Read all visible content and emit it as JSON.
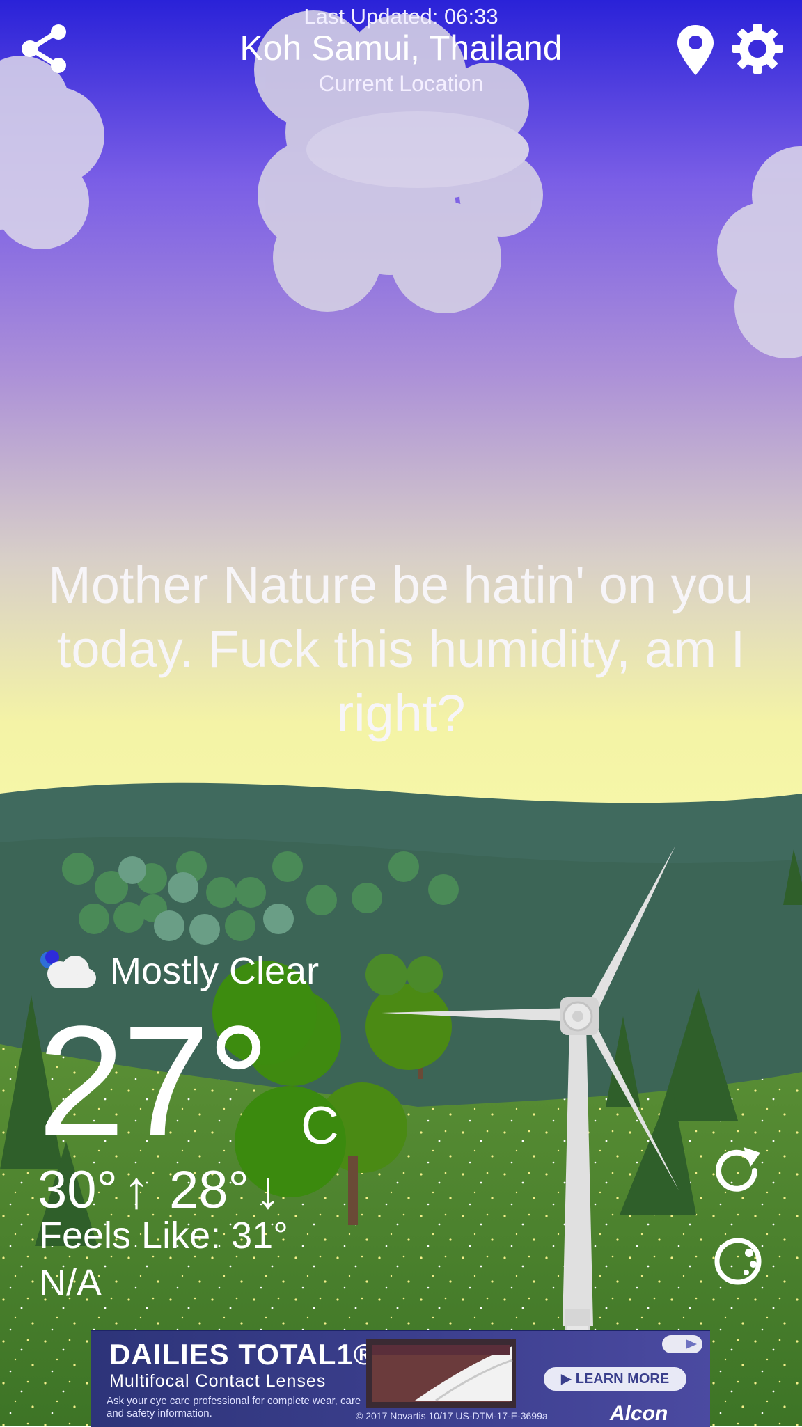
{
  "header": {
    "last_updated": "Last Updated: 06:33",
    "location": "Koh Samui, Thailand",
    "location_subtitle": "Current Location"
  },
  "message": "Mother Nature be hatin' on you today. Fuck this humidity, am I right?",
  "weather": {
    "condition_icon": "partly-cloudy-night-icon",
    "condition": "Mostly Clear",
    "temperature": "27°",
    "unit": "C",
    "high": "30°",
    "low": "28°",
    "high_arrow": "↑",
    "low_arrow": "↓",
    "feels_like_label": "Feels Like:",
    "feels_like_value": "31°",
    "extra": "N/A"
  },
  "actions": {
    "share_icon": "share-icon",
    "location_icon": "location-pin-icon",
    "settings_icon": "gear-icon",
    "refresh_icon": "refresh-icon",
    "moon_icon": "moon-icon"
  },
  "ad": {
    "brand": "DAILIES TOTAL1®",
    "subtitle": "Multifocal Contact Lenses",
    "note": "Ask your eye care professional for complete wear, care and safety information.",
    "copyright": "© 2017 Novartis    10/17    US-DTM-17-E-3699a",
    "cta": "▶ LEARN MORE",
    "sponsor": "Alcon"
  },
  "colors": {
    "sky_top": "#2a22d8",
    "sky_mid": "#8d6fe2",
    "horizon": "#f6f6a4",
    "hills_far": "#3e6b5e",
    "grass": "#4a7f2c",
    "ad_bg": "#2d3479"
  }
}
